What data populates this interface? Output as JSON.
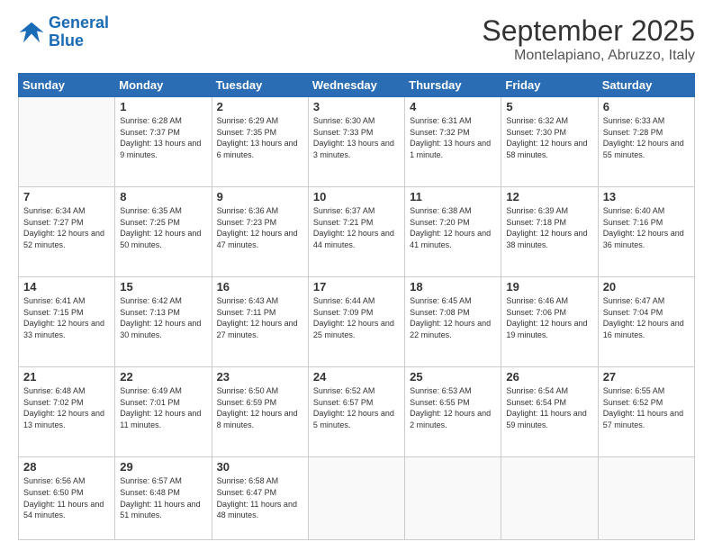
{
  "logo": {
    "line1": "General",
    "line2": "Blue"
  },
  "header": {
    "month": "September 2025",
    "location": "Montelapiano, Abruzzo, Italy"
  },
  "weekdays": [
    "Sunday",
    "Monday",
    "Tuesday",
    "Wednesday",
    "Thursday",
    "Friday",
    "Saturday"
  ],
  "weeks": [
    [
      {
        "day": "",
        "sunrise": "",
        "sunset": "",
        "daylight": ""
      },
      {
        "day": "1",
        "sunrise": "Sunrise: 6:28 AM",
        "sunset": "Sunset: 7:37 PM",
        "daylight": "Daylight: 13 hours and 9 minutes."
      },
      {
        "day": "2",
        "sunrise": "Sunrise: 6:29 AM",
        "sunset": "Sunset: 7:35 PM",
        "daylight": "Daylight: 13 hours and 6 minutes."
      },
      {
        "day": "3",
        "sunrise": "Sunrise: 6:30 AM",
        "sunset": "Sunset: 7:33 PM",
        "daylight": "Daylight: 13 hours and 3 minutes."
      },
      {
        "day": "4",
        "sunrise": "Sunrise: 6:31 AM",
        "sunset": "Sunset: 7:32 PM",
        "daylight": "Daylight: 13 hours and 1 minute."
      },
      {
        "day": "5",
        "sunrise": "Sunrise: 6:32 AM",
        "sunset": "Sunset: 7:30 PM",
        "daylight": "Daylight: 12 hours and 58 minutes."
      },
      {
        "day": "6",
        "sunrise": "Sunrise: 6:33 AM",
        "sunset": "Sunset: 7:28 PM",
        "daylight": "Daylight: 12 hours and 55 minutes."
      }
    ],
    [
      {
        "day": "7",
        "sunrise": "Sunrise: 6:34 AM",
        "sunset": "Sunset: 7:27 PM",
        "daylight": "Daylight: 12 hours and 52 minutes."
      },
      {
        "day": "8",
        "sunrise": "Sunrise: 6:35 AM",
        "sunset": "Sunset: 7:25 PM",
        "daylight": "Daylight: 12 hours and 50 minutes."
      },
      {
        "day": "9",
        "sunrise": "Sunrise: 6:36 AM",
        "sunset": "Sunset: 7:23 PM",
        "daylight": "Daylight: 12 hours and 47 minutes."
      },
      {
        "day": "10",
        "sunrise": "Sunrise: 6:37 AM",
        "sunset": "Sunset: 7:21 PM",
        "daylight": "Daylight: 12 hours and 44 minutes."
      },
      {
        "day": "11",
        "sunrise": "Sunrise: 6:38 AM",
        "sunset": "Sunset: 7:20 PM",
        "daylight": "Daylight: 12 hours and 41 minutes."
      },
      {
        "day": "12",
        "sunrise": "Sunrise: 6:39 AM",
        "sunset": "Sunset: 7:18 PM",
        "daylight": "Daylight: 12 hours and 38 minutes."
      },
      {
        "day": "13",
        "sunrise": "Sunrise: 6:40 AM",
        "sunset": "Sunset: 7:16 PM",
        "daylight": "Daylight: 12 hours and 36 minutes."
      }
    ],
    [
      {
        "day": "14",
        "sunrise": "Sunrise: 6:41 AM",
        "sunset": "Sunset: 7:15 PM",
        "daylight": "Daylight: 12 hours and 33 minutes."
      },
      {
        "day": "15",
        "sunrise": "Sunrise: 6:42 AM",
        "sunset": "Sunset: 7:13 PM",
        "daylight": "Daylight: 12 hours and 30 minutes."
      },
      {
        "day": "16",
        "sunrise": "Sunrise: 6:43 AM",
        "sunset": "Sunset: 7:11 PM",
        "daylight": "Daylight: 12 hours and 27 minutes."
      },
      {
        "day": "17",
        "sunrise": "Sunrise: 6:44 AM",
        "sunset": "Sunset: 7:09 PM",
        "daylight": "Daylight: 12 hours and 25 minutes."
      },
      {
        "day": "18",
        "sunrise": "Sunrise: 6:45 AM",
        "sunset": "Sunset: 7:08 PM",
        "daylight": "Daylight: 12 hours and 22 minutes."
      },
      {
        "day": "19",
        "sunrise": "Sunrise: 6:46 AM",
        "sunset": "Sunset: 7:06 PM",
        "daylight": "Daylight: 12 hours and 19 minutes."
      },
      {
        "day": "20",
        "sunrise": "Sunrise: 6:47 AM",
        "sunset": "Sunset: 7:04 PM",
        "daylight": "Daylight: 12 hours and 16 minutes."
      }
    ],
    [
      {
        "day": "21",
        "sunrise": "Sunrise: 6:48 AM",
        "sunset": "Sunset: 7:02 PM",
        "daylight": "Daylight: 12 hours and 13 minutes."
      },
      {
        "day": "22",
        "sunrise": "Sunrise: 6:49 AM",
        "sunset": "Sunset: 7:01 PM",
        "daylight": "Daylight: 12 hours and 11 minutes."
      },
      {
        "day": "23",
        "sunrise": "Sunrise: 6:50 AM",
        "sunset": "Sunset: 6:59 PM",
        "daylight": "Daylight: 12 hours and 8 minutes."
      },
      {
        "day": "24",
        "sunrise": "Sunrise: 6:52 AM",
        "sunset": "Sunset: 6:57 PM",
        "daylight": "Daylight: 12 hours and 5 minutes."
      },
      {
        "day": "25",
        "sunrise": "Sunrise: 6:53 AM",
        "sunset": "Sunset: 6:55 PM",
        "daylight": "Daylight: 12 hours and 2 minutes."
      },
      {
        "day": "26",
        "sunrise": "Sunrise: 6:54 AM",
        "sunset": "Sunset: 6:54 PM",
        "daylight": "Daylight: 11 hours and 59 minutes."
      },
      {
        "day": "27",
        "sunrise": "Sunrise: 6:55 AM",
        "sunset": "Sunset: 6:52 PM",
        "daylight": "Daylight: 11 hours and 57 minutes."
      }
    ],
    [
      {
        "day": "28",
        "sunrise": "Sunrise: 6:56 AM",
        "sunset": "Sunset: 6:50 PM",
        "daylight": "Daylight: 11 hours and 54 minutes."
      },
      {
        "day": "29",
        "sunrise": "Sunrise: 6:57 AM",
        "sunset": "Sunset: 6:48 PM",
        "daylight": "Daylight: 11 hours and 51 minutes."
      },
      {
        "day": "30",
        "sunrise": "Sunrise: 6:58 AM",
        "sunset": "Sunset: 6:47 PM",
        "daylight": "Daylight: 11 hours and 48 minutes."
      },
      {
        "day": "",
        "sunrise": "",
        "sunset": "",
        "daylight": ""
      },
      {
        "day": "",
        "sunrise": "",
        "sunset": "",
        "daylight": ""
      },
      {
        "day": "",
        "sunrise": "",
        "sunset": "",
        "daylight": ""
      },
      {
        "day": "",
        "sunrise": "",
        "sunset": "",
        "daylight": ""
      }
    ]
  ]
}
